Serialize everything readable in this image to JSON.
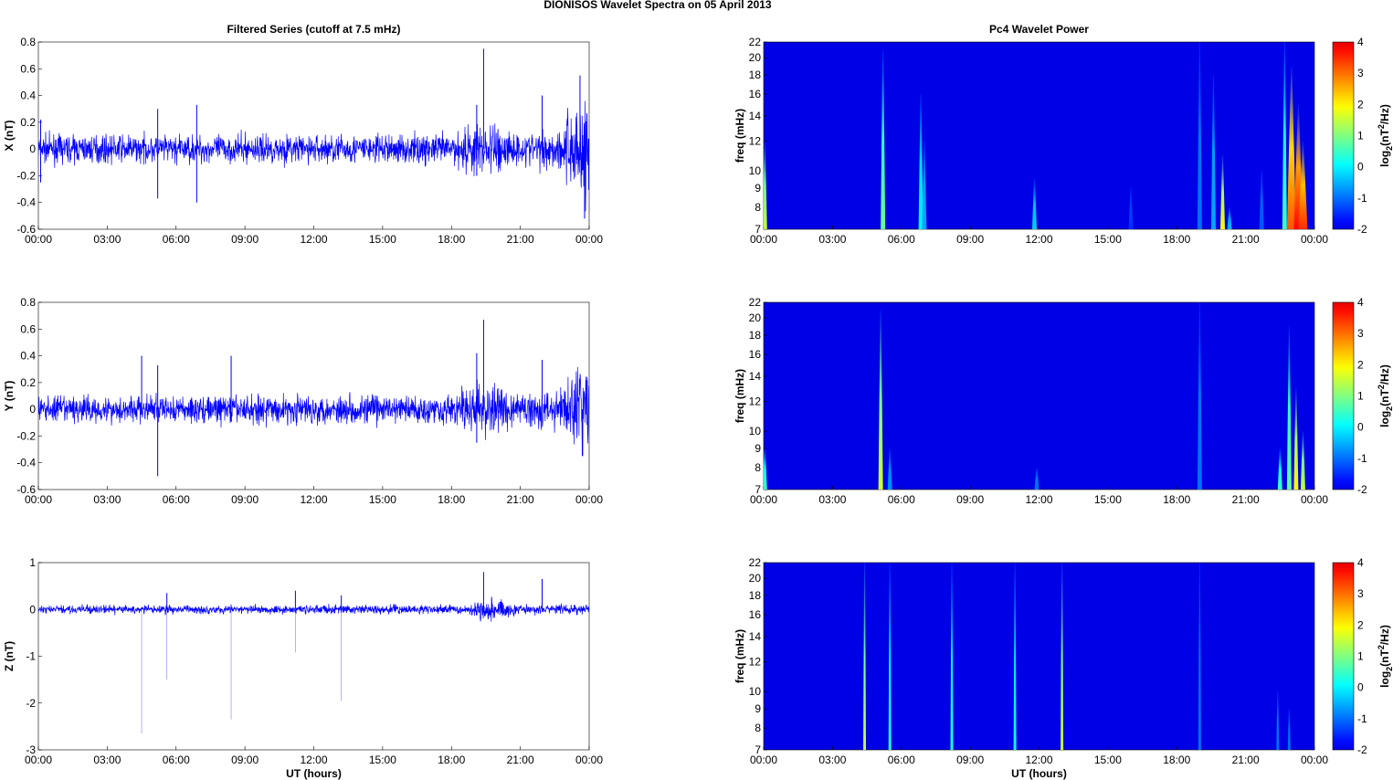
{
  "title": "DIONISOS Wavelet Spectra on 05 April     2013",
  "chart_data": [
    {
      "type": "line",
      "title": "Filtered Series (cutoff at 7.5 mHz)",
      "ylabel": "X (nT)",
      "xlabel": "",
      "ylim": [
        -0.6,
        0.8
      ],
      "yticks": [
        "-0.6",
        "-0.4",
        "-0.2",
        "0",
        "0.2",
        "0.4",
        "0.6",
        "0.8"
      ],
      "ytick_values": [
        -0.6,
        -0.4,
        -0.2,
        0,
        0.2,
        0.4,
        0.6,
        0.8
      ],
      "xticks": [
        "00:00",
        "03:00",
        "06:00",
        "09:00",
        "12:00",
        "15:00",
        "18:00",
        "21:00",
        "00:00"
      ],
      "xlim_hours": [
        0,
        24
      ],
      "noise_envelope": [
        [
          0,
          0.07
        ],
        [
          18,
          0.08
        ],
        [
          18.8,
          0.14
        ],
        [
          20.2,
          0.14
        ],
        [
          21,
          0.08
        ],
        [
          22.8,
          0.12
        ],
        [
          23.4,
          0.3
        ],
        [
          24,
          0.3
        ]
      ],
      "spikes": [
        [
          0.1,
          0.22
        ],
        [
          0.1,
          -0.25
        ],
        [
          5.2,
          0.3
        ],
        [
          5.2,
          -0.37
        ],
        [
          6.9,
          0.33
        ],
        [
          6.9,
          -0.4
        ],
        [
          19.1,
          0.33
        ],
        [
          19.1,
          -0.2
        ],
        [
          19.4,
          0.75
        ],
        [
          21.95,
          0.4
        ],
        [
          23.6,
          0.55
        ],
        [
          23.8,
          -0.52
        ]
      ],
      "color": "#0000ff"
    },
    {
      "type": "line",
      "title": "",
      "ylabel": "Y (nT)",
      "xlabel": "",
      "ylim": [
        -0.6,
        0.8
      ],
      "yticks": [
        "-0.6",
        "-0.4",
        "-0.2",
        "0",
        "0.2",
        "0.4",
        "0.6",
        "0.8"
      ],
      "ytick_values": [
        -0.6,
        -0.4,
        -0.2,
        0,
        0.2,
        0.4,
        0.6,
        0.8
      ],
      "xticks": [
        "00:00",
        "03:00",
        "06:00",
        "09:00",
        "12:00",
        "15:00",
        "18:00",
        "21:00",
        "00:00"
      ],
      "xlim_hours": [
        0,
        24
      ],
      "noise_envelope": [
        [
          0,
          0.07
        ],
        [
          18,
          0.08
        ],
        [
          18.8,
          0.13
        ],
        [
          20.2,
          0.13
        ],
        [
          21,
          0.08
        ],
        [
          23,
          0.12
        ],
        [
          23.5,
          0.25
        ],
        [
          24,
          0.25
        ]
      ],
      "spikes": [
        [
          4.5,
          0.4
        ],
        [
          5.2,
          0.33
        ],
        [
          5.2,
          -0.5
        ],
        [
          8.4,
          0.4
        ],
        [
          19.1,
          0.42
        ],
        [
          19.1,
          -0.25
        ],
        [
          19.4,
          0.67
        ],
        [
          21.95,
          0.37
        ],
        [
          23.7,
          -0.35
        ]
      ],
      "color": "#0000ff"
    },
    {
      "type": "line",
      "title": "",
      "ylabel": "Z (nT)",
      "xlabel": "UT (hours)",
      "ylim": [
        -3,
        1
      ],
      "yticks": [
        "-3",
        "-2",
        "-1",
        "0",
        "1"
      ],
      "ytick_values": [
        -3,
        -2,
        -1,
        0,
        1
      ],
      "xticks": [
        "00:00",
        "03:00",
        "06:00",
        "09:00",
        "12:00",
        "15:00",
        "18:00",
        "21:00",
        "00:00"
      ],
      "xlim_hours": [
        0,
        24
      ],
      "noise_envelope": [
        [
          0,
          0.06
        ],
        [
          18.8,
          0.07
        ],
        [
          19.2,
          0.15
        ],
        [
          20.2,
          0.15
        ],
        [
          21,
          0.07
        ],
        [
          24,
          0.08
        ]
      ],
      "spikes": [
        [
          4.5,
          -2.65
        ],
        [
          5.6,
          -1.5
        ],
        [
          5.6,
          0.35
        ],
        [
          8.4,
          -2.35
        ],
        [
          11.2,
          -0.92
        ],
        [
          11.2,
          0.4
        ],
        [
          13.2,
          -1.95
        ],
        [
          13.2,
          0.3
        ],
        [
          19.4,
          0.8
        ],
        [
          21.95,
          0.65
        ]
      ],
      "color": "#0000ff"
    },
    {
      "type": "heatmap",
      "title": "Pc4 Wavelet Power",
      "ylabel": "freq (mHz)",
      "xlabel": "",
      "ylim": [
        7,
        22
      ],
      "yscale": "log",
      "yticks": [
        "7",
        "8",
        "9",
        "10",
        "12",
        "14",
        "16",
        "18",
        "20",
        "22"
      ],
      "ytick_values": [
        7,
        8,
        9,
        10,
        12,
        14,
        16,
        18,
        20,
        22
      ],
      "xticks": [
        "00:00",
        "03:00",
        "06:00",
        "09:00",
        "12:00",
        "15:00",
        "18:00",
        "21:00",
        "00:00"
      ],
      "xlim_hours": [
        0,
        24
      ],
      "colorbar": {
        "label": "log2(nT^2/Hz)",
        "clim": [
          -2,
          4
        ],
        "ticks": [
          "-2",
          "-1",
          "0",
          "1",
          "2",
          "3",
          "4"
        ]
      },
      "background": -2,
      "events": [
        [
          0.05,
          7,
          12,
          1.5
        ],
        [
          5.2,
          7,
          21,
          0.8
        ],
        [
          6.85,
          7,
          16,
          0
        ],
        [
          7.0,
          7,
          12,
          -0.6
        ],
        [
          11.8,
          7,
          9.5,
          -0.3
        ],
        [
          16,
          7,
          9,
          -1.5
        ],
        [
          19.0,
          7,
          22,
          -1
        ],
        [
          19.6,
          7,
          18,
          -0.6
        ],
        [
          20.0,
          7,
          11,
          2
        ],
        [
          20.3,
          7,
          8,
          -0.5
        ],
        [
          21.7,
          7,
          10,
          -1.2
        ],
        [
          22.7,
          7,
          22,
          0.5
        ],
        [
          23.0,
          7,
          19,
          3.2
        ],
        [
          23.3,
          7,
          15,
          3.8
        ],
        [
          23.5,
          7,
          12,
          3.5
        ]
      ]
    },
    {
      "type": "heatmap",
      "title": "",
      "ylabel": "freq (mHz)",
      "xlabel": "",
      "ylim": [
        7,
        22
      ],
      "yscale": "log",
      "yticks": [
        "7",
        "8",
        "9",
        "10",
        "12",
        "14",
        "16",
        "18",
        "20",
        "22"
      ],
      "ytick_values": [
        7,
        8,
        9,
        10,
        12,
        14,
        16,
        18,
        20,
        22
      ],
      "xticks": [
        "00:00",
        "03:00",
        "06:00",
        "09:00",
        "12:00",
        "15:00",
        "18:00",
        "21:00",
        "00:00"
      ],
      "xlim_hours": [
        0,
        24
      ],
      "colorbar": {
        "label": "log2(nT^2/Hz)",
        "clim": [
          -2,
          4
        ],
        "ticks": [
          "-2",
          "-1",
          "0",
          "1",
          "2",
          "3",
          "4"
        ]
      },
      "background": -2,
      "events": [
        [
          0.05,
          7,
          9,
          0.5
        ],
        [
          5.1,
          7,
          21,
          1.6
        ],
        [
          5.5,
          7,
          9,
          -0.8
        ],
        [
          11.9,
          7,
          8,
          -1
        ],
        [
          19.0,
          7,
          22,
          -1
        ],
        [
          22.5,
          7,
          9,
          0.5
        ],
        [
          22.9,
          7,
          19,
          0.8
        ],
        [
          23.2,
          7,
          13,
          2
        ],
        [
          23.5,
          7,
          10,
          1.5
        ]
      ]
    },
    {
      "type": "heatmap",
      "title": "",
      "ylabel": "freq (mHz)",
      "xlabel": "UT (hours)",
      "ylim": [
        7,
        22
      ],
      "yscale": "log",
      "yticks": [
        "7",
        "8",
        "9",
        "10",
        "12",
        "14",
        "16",
        "18",
        "20",
        "22"
      ],
      "ytick_values": [
        7,
        8,
        9,
        10,
        12,
        14,
        16,
        18,
        20,
        22
      ],
      "xticks": [
        "00:00",
        "03:00",
        "06:00",
        "09:00",
        "12:00",
        "15:00",
        "18:00",
        "21:00",
        "00:00"
      ],
      "xlim_hours": [
        0,
        24
      ],
      "colorbar": {
        "label": "log2(nT^2/Hz)",
        "clim": [
          -2,
          4
        ],
        "ticks": [
          "-2",
          "-1",
          "0",
          "1",
          "2",
          "3",
          "4"
        ]
      },
      "background": -2,
      "events": [
        [
          4.4,
          7,
          22,
          1.5
        ],
        [
          5.5,
          7,
          22,
          0.3
        ],
        [
          8.2,
          7,
          22,
          0.3
        ],
        [
          10.95,
          7,
          22,
          0.1
        ],
        [
          13.0,
          7,
          22,
          1.5
        ],
        [
          19.0,
          7,
          22,
          -1
        ],
        [
          22.4,
          7,
          10,
          -1
        ],
        [
          22.9,
          7,
          9,
          -1
        ]
      ]
    }
  ]
}
